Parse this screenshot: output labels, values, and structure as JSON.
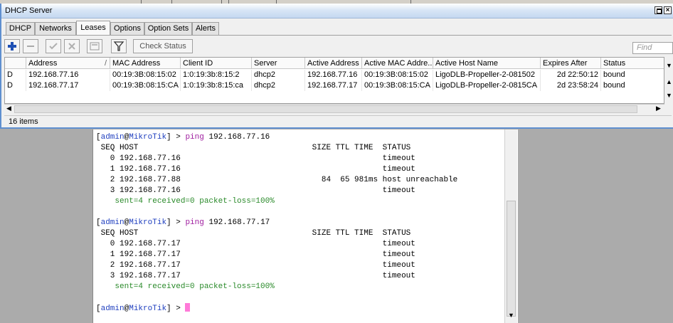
{
  "window": {
    "title": "DHCP Server"
  },
  "tabs": [
    "DHCP",
    "Networks",
    "Leases",
    "Options",
    "Option Sets",
    "Alerts"
  ],
  "active_tab": "Leases",
  "toolbar": {
    "check_status_label": "Check Status",
    "find_placeholder": "Find"
  },
  "columns": [
    "",
    "Address",
    "MAC Address",
    "Client ID",
    "Server",
    "Active Address",
    "Active MAC Addre...",
    "Active Host Name",
    "Expires After",
    "Status"
  ],
  "sort_indicator": "/",
  "rows": [
    [
      "D",
      "192.168.77.16",
      "00:19:3B:08:15:02",
      "1:0:19:3b:8:15:2",
      "dhcp2",
      "192.168.77.16",
      "00:19:3B:08:15:02",
      "LigoDLB-Propeller-2-081502",
      "2d 22:50:12",
      "bound"
    ],
    [
      "D",
      "192.168.77.17",
      "00:19:3B:08:15:CA",
      "1:0:19:3b:8:15:ca",
      "dhcp2",
      "192.168.77.17",
      "00:19:3B:08:15:CA",
      "LigoDLB-Propeller-2-0815CA",
      "2d 23:58:24",
      "bound"
    ]
  ],
  "status": {
    "items_count": "16 items"
  },
  "terminal": {
    "prompt_user": "admin",
    "prompt_host": "MikroTik",
    "ping1": {
      "command": "ping",
      "target": "192.168.77.16",
      "header": " SEQ HOST                                     SIZE TTL TIME  STATUS",
      "lines": [
        "   0 192.168.77.16                                           timeout",
        "   1 192.168.77.16                                           timeout",
        "   2 192.168.77.88                              84  65 981ms host unreachable",
        "   3 192.168.77.16                                           timeout"
      ],
      "summary": "    sent=4 received=0 packet-loss=100%"
    },
    "ping2": {
      "command": "ping",
      "target": "192.168.77.17",
      "header": " SEQ HOST                                     SIZE TTL TIME  STATUS",
      "lines": [
        "   0 192.168.77.17                                           timeout",
        "   1 192.168.77.17                                           timeout",
        "   2 192.168.77.17                                           timeout",
        "   3 192.168.77.17                                           timeout"
      ],
      "summary": "    sent=4 received=0 packet-loss=100%"
    }
  },
  "colors": {
    "prompt": "#1f3fbf",
    "command": "#a020a0",
    "summary": "#2a8a2a",
    "cursor": "#ff7ad8",
    "border": "#5f8fd0"
  },
  "icons": [
    "plus-icon",
    "minus-icon",
    "check-icon",
    "cross-icon",
    "comment-icon",
    "filter-icon",
    "restore-icon",
    "close-icon"
  ]
}
